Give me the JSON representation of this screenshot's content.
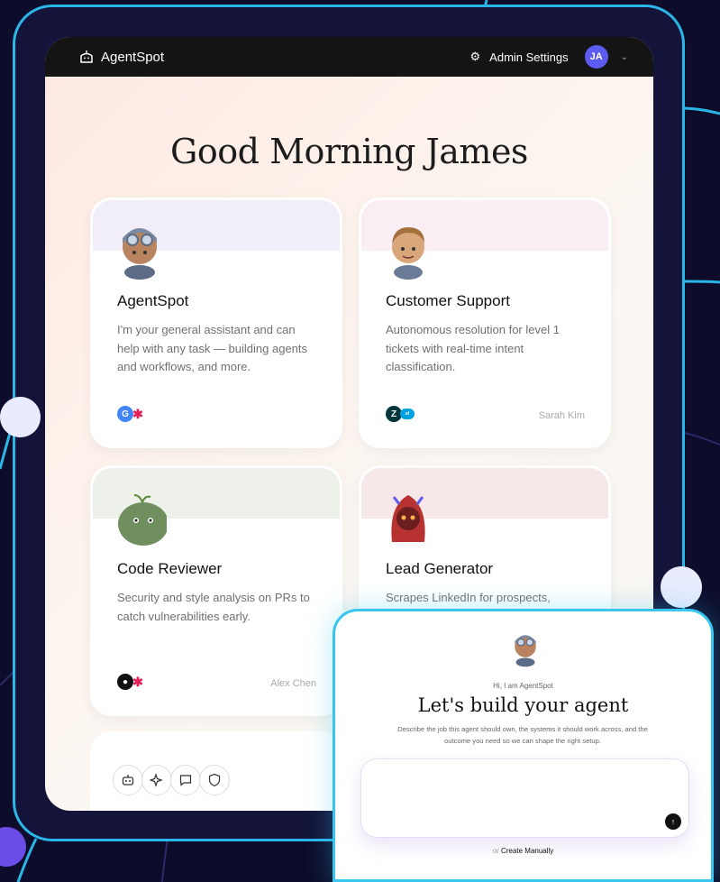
{
  "header": {
    "brand": "AgentSpot",
    "admin_label": "Admin Settings",
    "user_initials": "JA"
  },
  "greeting": "Good Morning James",
  "cards": [
    {
      "title": "AgentSpot",
      "description": "I'm your general assistant and can help with any task — building agents and workflows, and more.",
      "owner": "",
      "band_color": "#f1eefa",
      "integrations": [
        "google-icon",
        "slack-icon"
      ]
    },
    {
      "title": "Customer Support",
      "description": "Autonomous resolution for level 1 tickets with real-time intent classification.",
      "owner": "Sarah Kim",
      "band_color": "#f8eef4",
      "integrations": [
        "zendesk-icon",
        "salesforce-icon"
      ]
    },
    {
      "title": "Code Reviewer",
      "description": "Security and style analysis on PRs to catch vulnerabilities early.",
      "owner": "Alex Chen",
      "band_color": "#eef0ea",
      "integrations": [
        "github-icon",
        "slack-icon"
      ]
    },
    {
      "title": "Lead Generator",
      "description": "Scrapes LinkedIn for prospects,",
      "owner": "",
      "band_color": "#f6e8e8",
      "integrations": []
    }
  ],
  "tools": [
    "bot-icon",
    "sparkles-icon",
    "chat-icon",
    "shield-icon"
  ],
  "builder": {
    "greeting": "Hi, I am AgentSpot",
    "heading": "Let's build your agent",
    "subtext": "Describe the job this agent should own, the systems it should work across, and the outcome you need so we can shape the right setup.",
    "input_value": "",
    "or_label": "or",
    "manual_link": "Create Manually"
  },
  "colors": {
    "accent": "#5d5cf0",
    "frame": "#2bb6e8",
    "topbar": "#141414"
  }
}
